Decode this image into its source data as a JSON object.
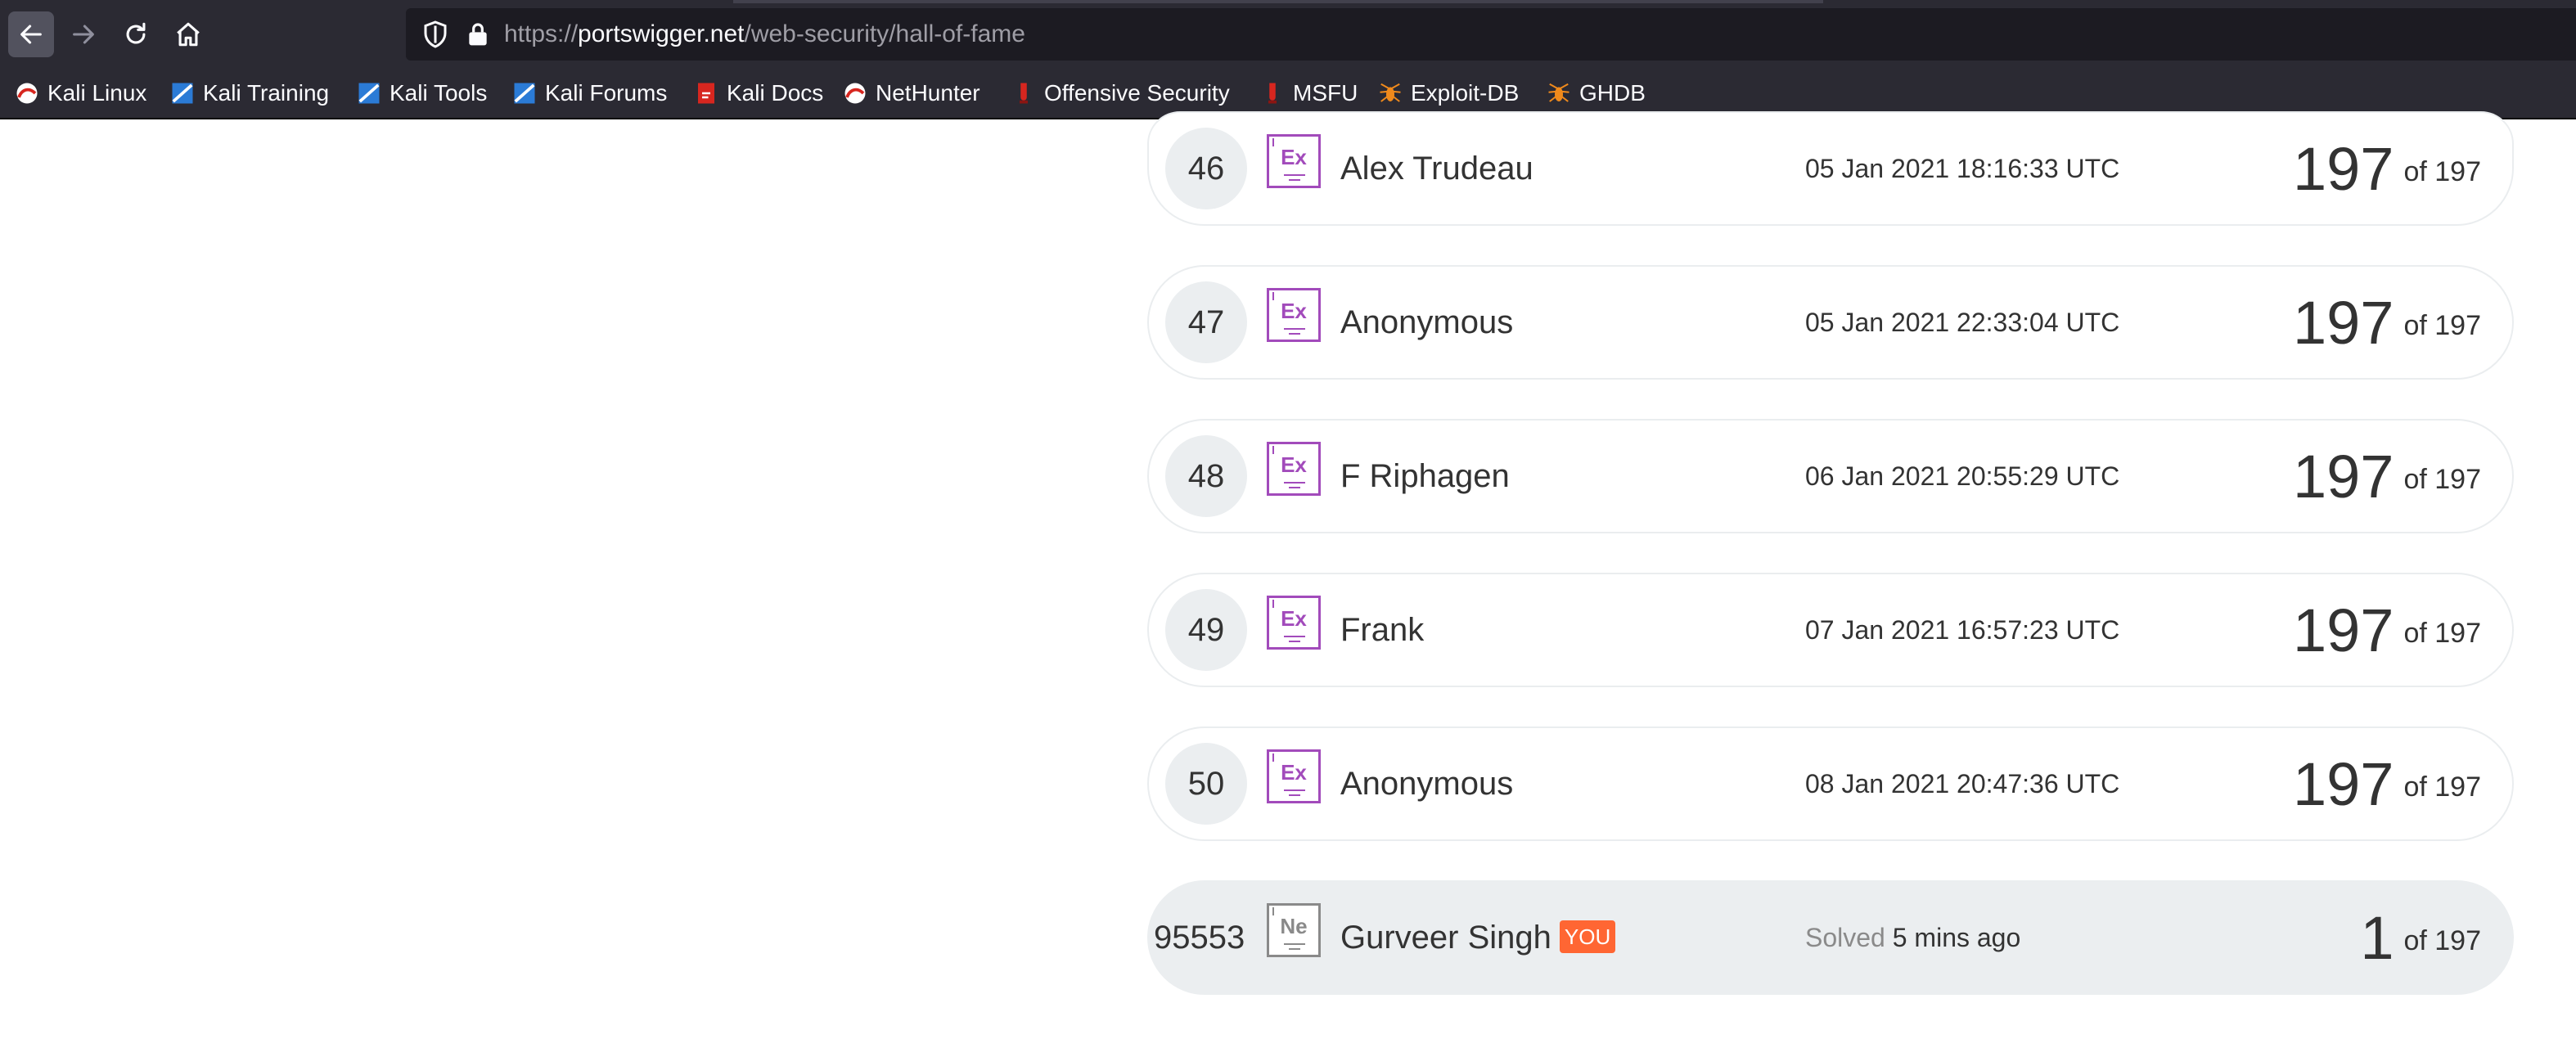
{
  "browser": {
    "url_scheme": "https://",
    "url_host": "portswigger.net",
    "url_path": "/web-security/hall-of-fame",
    "bookmarks": [
      {
        "label": "Kali Linux",
        "icon": "kali-icon"
      },
      {
        "label": "Kali Training",
        "icon": "kali-training-icon"
      },
      {
        "label": "Kali Tools",
        "icon": "kali-tools-icon"
      },
      {
        "label": "Kali Forums",
        "icon": "kali-forums-icon"
      },
      {
        "label": "Kali Docs",
        "icon": "kali-docs-icon"
      },
      {
        "label": "NetHunter",
        "icon": "nethunter-icon"
      },
      {
        "label": "Offensive Security",
        "icon": "offsec-icon"
      },
      {
        "label": "MSFU",
        "icon": "msfu-icon"
      },
      {
        "label": "Exploit-DB",
        "icon": "exploit-db-icon"
      },
      {
        "label": "GHDB",
        "icon": "ghdb-icon"
      }
    ]
  },
  "leaderboard": {
    "rows": [
      {
        "rank": "46",
        "level": "Ex",
        "name": "Alex Trudeau",
        "date": "05 Jan 2021 18:16:33 UTC",
        "score": "197",
        "of": "of 197"
      },
      {
        "rank": "47",
        "level": "Ex",
        "name": "Anonymous",
        "date": "05 Jan 2021 22:33:04 UTC",
        "score": "197",
        "of": "of 197"
      },
      {
        "rank": "48",
        "level": "Ex",
        "name": "F Riphagen",
        "date": "06 Jan 2021 20:55:29 UTC",
        "score": "197",
        "of": "of 197"
      },
      {
        "rank": "49",
        "level": "Ex",
        "name": "Frank",
        "date": "07 Jan 2021 16:57:23 UTC",
        "score": "197",
        "of": "of 197"
      },
      {
        "rank": "50",
        "level": "Ex",
        "name": "Anonymous",
        "date": "08 Jan 2021 20:47:36 UTC",
        "score": "197",
        "of": "of 197"
      }
    ],
    "me": {
      "rank": "95553",
      "level": "Ne",
      "name": "Gurveer Singh",
      "you_tag": "YOU",
      "solved_label": "Solved",
      "solved_when": "5 mins ago",
      "score": "1",
      "of": "of 197"
    }
  },
  "colors": {
    "expert": "#a24bbb",
    "you_tag": "#ff6633",
    "chrome": "#2b2a33"
  }
}
